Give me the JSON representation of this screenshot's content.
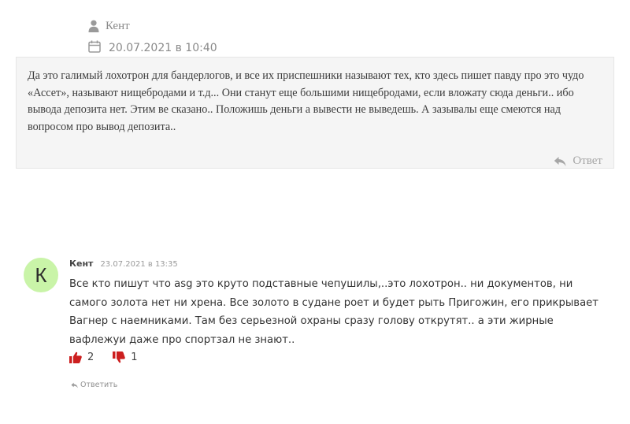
{
  "comment1": {
    "author": "Кент",
    "date": "20.07.2021 в 10:40",
    "text": "Да это галимый лохотрон для бандерлогов, и все их приспешники называют тех, кто здесь пишет павду про это чудо «Ассет», называют нищебродами и т.д... Они станут еще большими нищебродами, если вложату сюда деньги.. ибо вывода депозита нет. Этим ве сказано.. Положишь деньги а вывести не выведешь. А зазывалы еще смеются над вопросом про вывод депозита..",
    "reply_label": "Ответ",
    "icons": {
      "author": "user-icon",
      "date": "calendar-icon",
      "reply": "reply-icon"
    }
  },
  "comment2": {
    "avatar_letter": "К",
    "avatar_color": "#c9f4a8",
    "author": "Кент",
    "date": "23.07.2021 в 13:35",
    "text": "Все кто пишут что asg это круто подставные чепушилы,..это лохотрон.. ни документов, ни самого золота нет ни хрена. Все золото в судане роет и будет рыть Пригожин, его прикрывает Вагнер с наемниками. Там без серьезной охраны сразу голову открутят.. а эти жирные вафлежуи даже про спортзал не знают..",
    "likes": "2",
    "dislikes": "1",
    "vote_color": "#cc1f1f",
    "reply_label": "Ответить",
    "icons": {
      "like": "thumbs-up-icon",
      "dislike": "thumbs-down-icon",
      "reply": "reply-icon"
    }
  }
}
